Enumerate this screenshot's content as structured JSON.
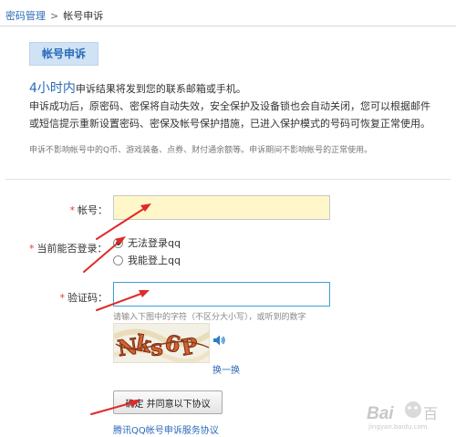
{
  "breadcrumb": {
    "parent": "密码管理",
    "separator": ">",
    "current": "帐号申诉"
  },
  "page": {
    "title": "帐号申诉"
  },
  "intro": {
    "hours": "4小时内",
    "line1_rest": "申诉结果将发到您的联系邮箱或手机。",
    "line2": "申诉成功后，原密码、密保将自动失效，安全保护及设备锁也会自动关闭，您可以根据邮件",
    "line3": "或短信提示重新设置密码、密保及帐号保护措施，已进入保护模式的号码可恢复正常使用。"
  },
  "note": "申诉不影响帐号中的Q币、游戏装备、点券、财付通余额等。申诉期间不影响帐号的正常使用。",
  "form": {
    "required_mark": "*",
    "account_label": "帐号：",
    "account_value": "",
    "login_label": "当前能否登录：",
    "options": [
      {
        "label": "无法登录qq",
        "checked": true
      },
      {
        "label": "我能登上qq",
        "checked": false
      }
    ],
    "captcha_label": "验证码：",
    "captcha_value": "",
    "captcha_hint": "请输入下图中的字符（不区分大小写），或听到的数字",
    "refresh_link": "换一换"
  },
  "actions": {
    "confirm": "确定  并同意以下协议",
    "agreement_link": "腾讯QQ帐号申诉服务协议"
  },
  "watermark": {
    "logo_text": "Bai",
    "logo_text_2": "百",
    "sub_text": "jingyan.baidu.com"
  },
  "colors": {
    "link": "#2a6ab8",
    "required": "#e23b2e",
    "account_bg": "#fff7c9",
    "arrow": "#e02a2a"
  }
}
